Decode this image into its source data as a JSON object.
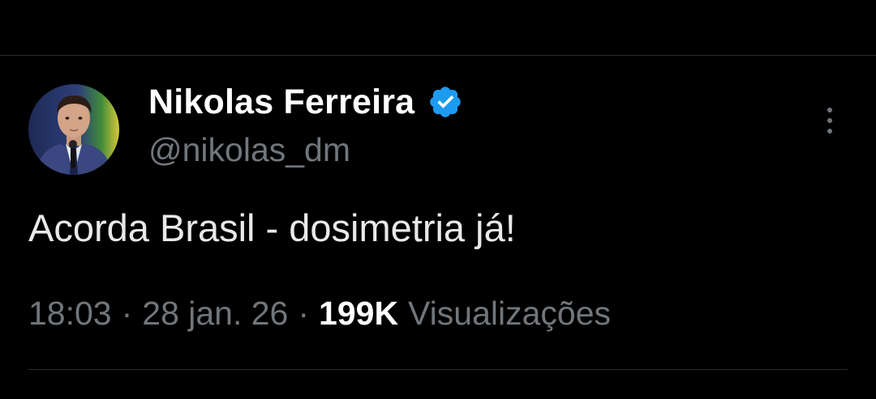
{
  "tweet": {
    "author": {
      "display_name": "Nikolas Ferreira",
      "handle": "@nikolas_dm",
      "verified": true,
      "verified_color": "#1d9bf0"
    },
    "text": "Acorda Brasil - dosimetria já!",
    "time": "18:03",
    "date": "28 jan. 26",
    "separator": "·",
    "views_count": "199K",
    "views_label": "Visualizações"
  },
  "icons": {
    "verified": "verified-badge-icon",
    "more": "more-vertical-icon"
  },
  "colors": {
    "background": "#000000",
    "primary_text": "#e7e9ea",
    "secondary_text": "#71767b",
    "divider": "#2a2d31"
  }
}
